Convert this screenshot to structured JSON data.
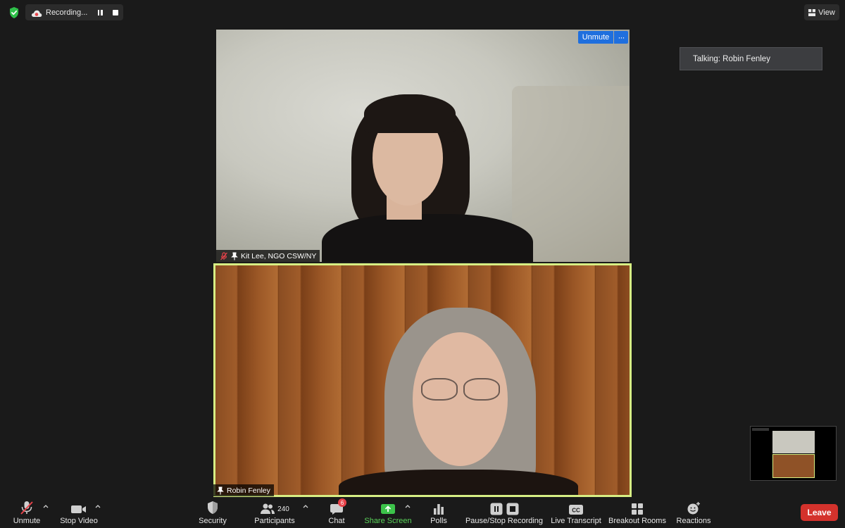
{
  "top_bar": {
    "recording_label": "Recording...",
    "view_label": "View"
  },
  "videos": [
    {
      "name": "Kit Lee, NGO CSW/NY",
      "muted": true,
      "overlay_unmute": "Unmute",
      "overlay_more": "···"
    },
    {
      "name": "Robin Fenley",
      "muted": false,
      "active_speaker": true
    }
  ],
  "talking_indicator": "Talking: Robin Fenley",
  "toolbar": {
    "unmute": "Unmute",
    "stop_video": "Stop Video",
    "security": "Security",
    "participants": "Participants",
    "participants_count": "240",
    "chat": "Chat",
    "chat_badge": "6",
    "share_screen": "Share Screen",
    "polls": "Polls",
    "pause_stop_recording": "Pause/Stop Recording",
    "live_transcript": "Live Transcript",
    "breakout_rooms": "Breakout Rooms",
    "reactions": "Reactions",
    "leave": "Leave"
  },
  "colors": {
    "accent_blue": "#1f6fde",
    "share_green": "#5ad35a",
    "leave_red": "#d4322c",
    "speaker_border": "#d7ef84",
    "badge_red": "#e8434a"
  },
  "icons": [
    "shield-check-icon",
    "recording-cloud-icon",
    "pause-icon",
    "stop-icon",
    "view-grid-icon",
    "mic-muted-icon",
    "pin-icon",
    "video-camera-icon",
    "security-shield-icon",
    "participants-icon",
    "chat-bubble-icon",
    "share-screen-icon",
    "polls-icon",
    "closed-caption-icon",
    "breakout-rooms-icon",
    "reactions-icon",
    "caret-up-icon"
  ]
}
